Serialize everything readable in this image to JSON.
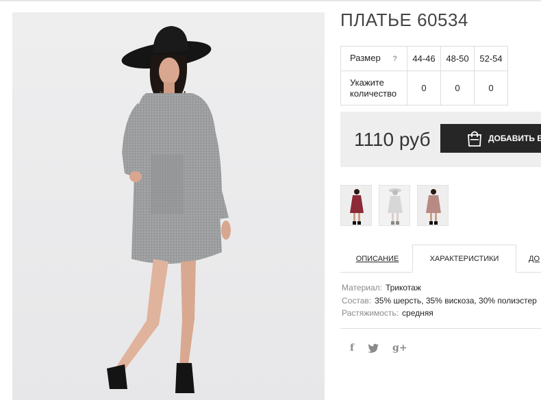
{
  "product": {
    "title": "ПЛАТЬЕ 60534",
    "photo_alt": "main-product-photo"
  },
  "size_table": {
    "size_label": "Размер",
    "help_glyph": "?",
    "sizes": [
      "44-46",
      "48-50",
      "52-54"
    ],
    "quantity_label_line1": "Укажите",
    "quantity_label_line2": "количество",
    "quantities": [
      "0",
      "0",
      "0"
    ]
  },
  "buy": {
    "price": "1110 руб",
    "add_button_label": "ДОБАВИТЬ В"
  },
  "thumbnails": [
    {
      "name": "burgundy",
      "dress_color": "#8c2a36"
    },
    {
      "name": "light-grey",
      "dress_color": "#d7d7d7"
    },
    {
      "name": "beige-pink",
      "dress_color": "#b78b84"
    }
  ],
  "tabs": {
    "description": "ОПИСАНИЕ",
    "characteristics": "ХАРАКТЕРИСТИКИ",
    "more": "ДО"
  },
  "characteristics": [
    {
      "key": "Материал:",
      "value": "Трикотаж"
    },
    {
      "key": "Состав:",
      "value": "35% шерсть, 35% вискоза, 30% полиэстер"
    },
    {
      "key": "Растяжимость:",
      "value": "средняя"
    }
  ],
  "social": {
    "facebook": "f",
    "google_plus": "g+"
  },
  "colors": {
    "button_bg": "#262626",
    "buybox_bg": "#eeeeee",
    "dress_grey": "#9a9c9e"
  }
}
